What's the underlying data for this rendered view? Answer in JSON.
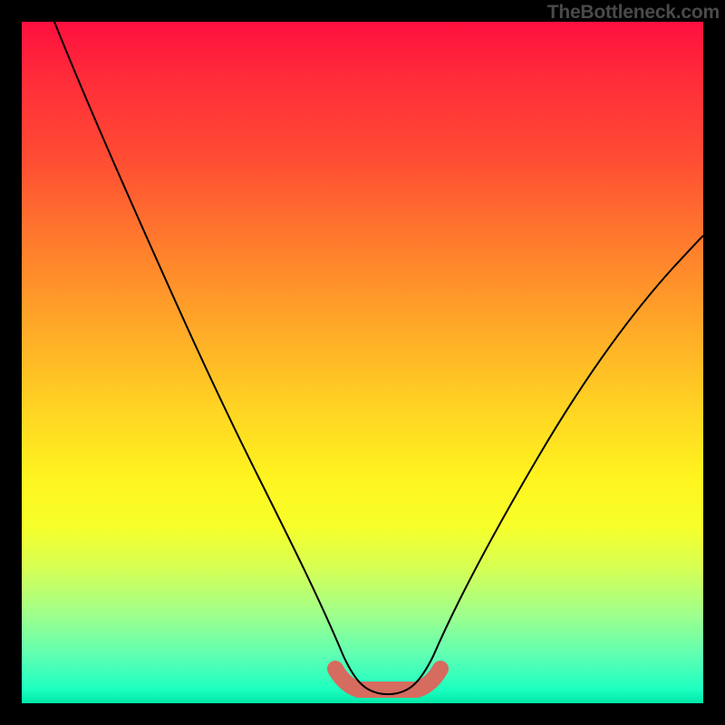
{
  "watermark": "TheBottleneck.com",
  "colors": {
    "gradient_top": "#ff0f3f",
    "gradient_bottom": "#00e8a8",
    "curve": "#000000",
    "accent": "#d66b5f",
    "frame": "#000000"
  },
  "chart_data": {
    "type": "line",
    "title": "",
    "xlabel": "",
    "ylabel": "",
    "ylim": [
      0,
      100
    ],
    "xlim": [
      0,
      100
    ],
    "series": [
      {
        "name": "bottleneck-curve",
        "x": [
          0,
          6,
          12,
          18,
          24,
          30,
          36,
          42,
          46,
          49,
          52,
          55,
          58,
          62,
          68,
          74,
          80,
          86,
          92,
          100
        ],
        "values": [
          100,
          88,
          76,
          64,
          52,
          40,
          28,
          16,
          8,
          3,
          1,
          1,
          3,
          8,
          18,
          28,
          38,
          47,
          55,
          65
        ]
      }
    ],
    "annotations": [
      {
        "name": "optimal-range",
        "x_start": 46,
        "x_end": 58,
        "y": 1
      }
    ]
  }
}
